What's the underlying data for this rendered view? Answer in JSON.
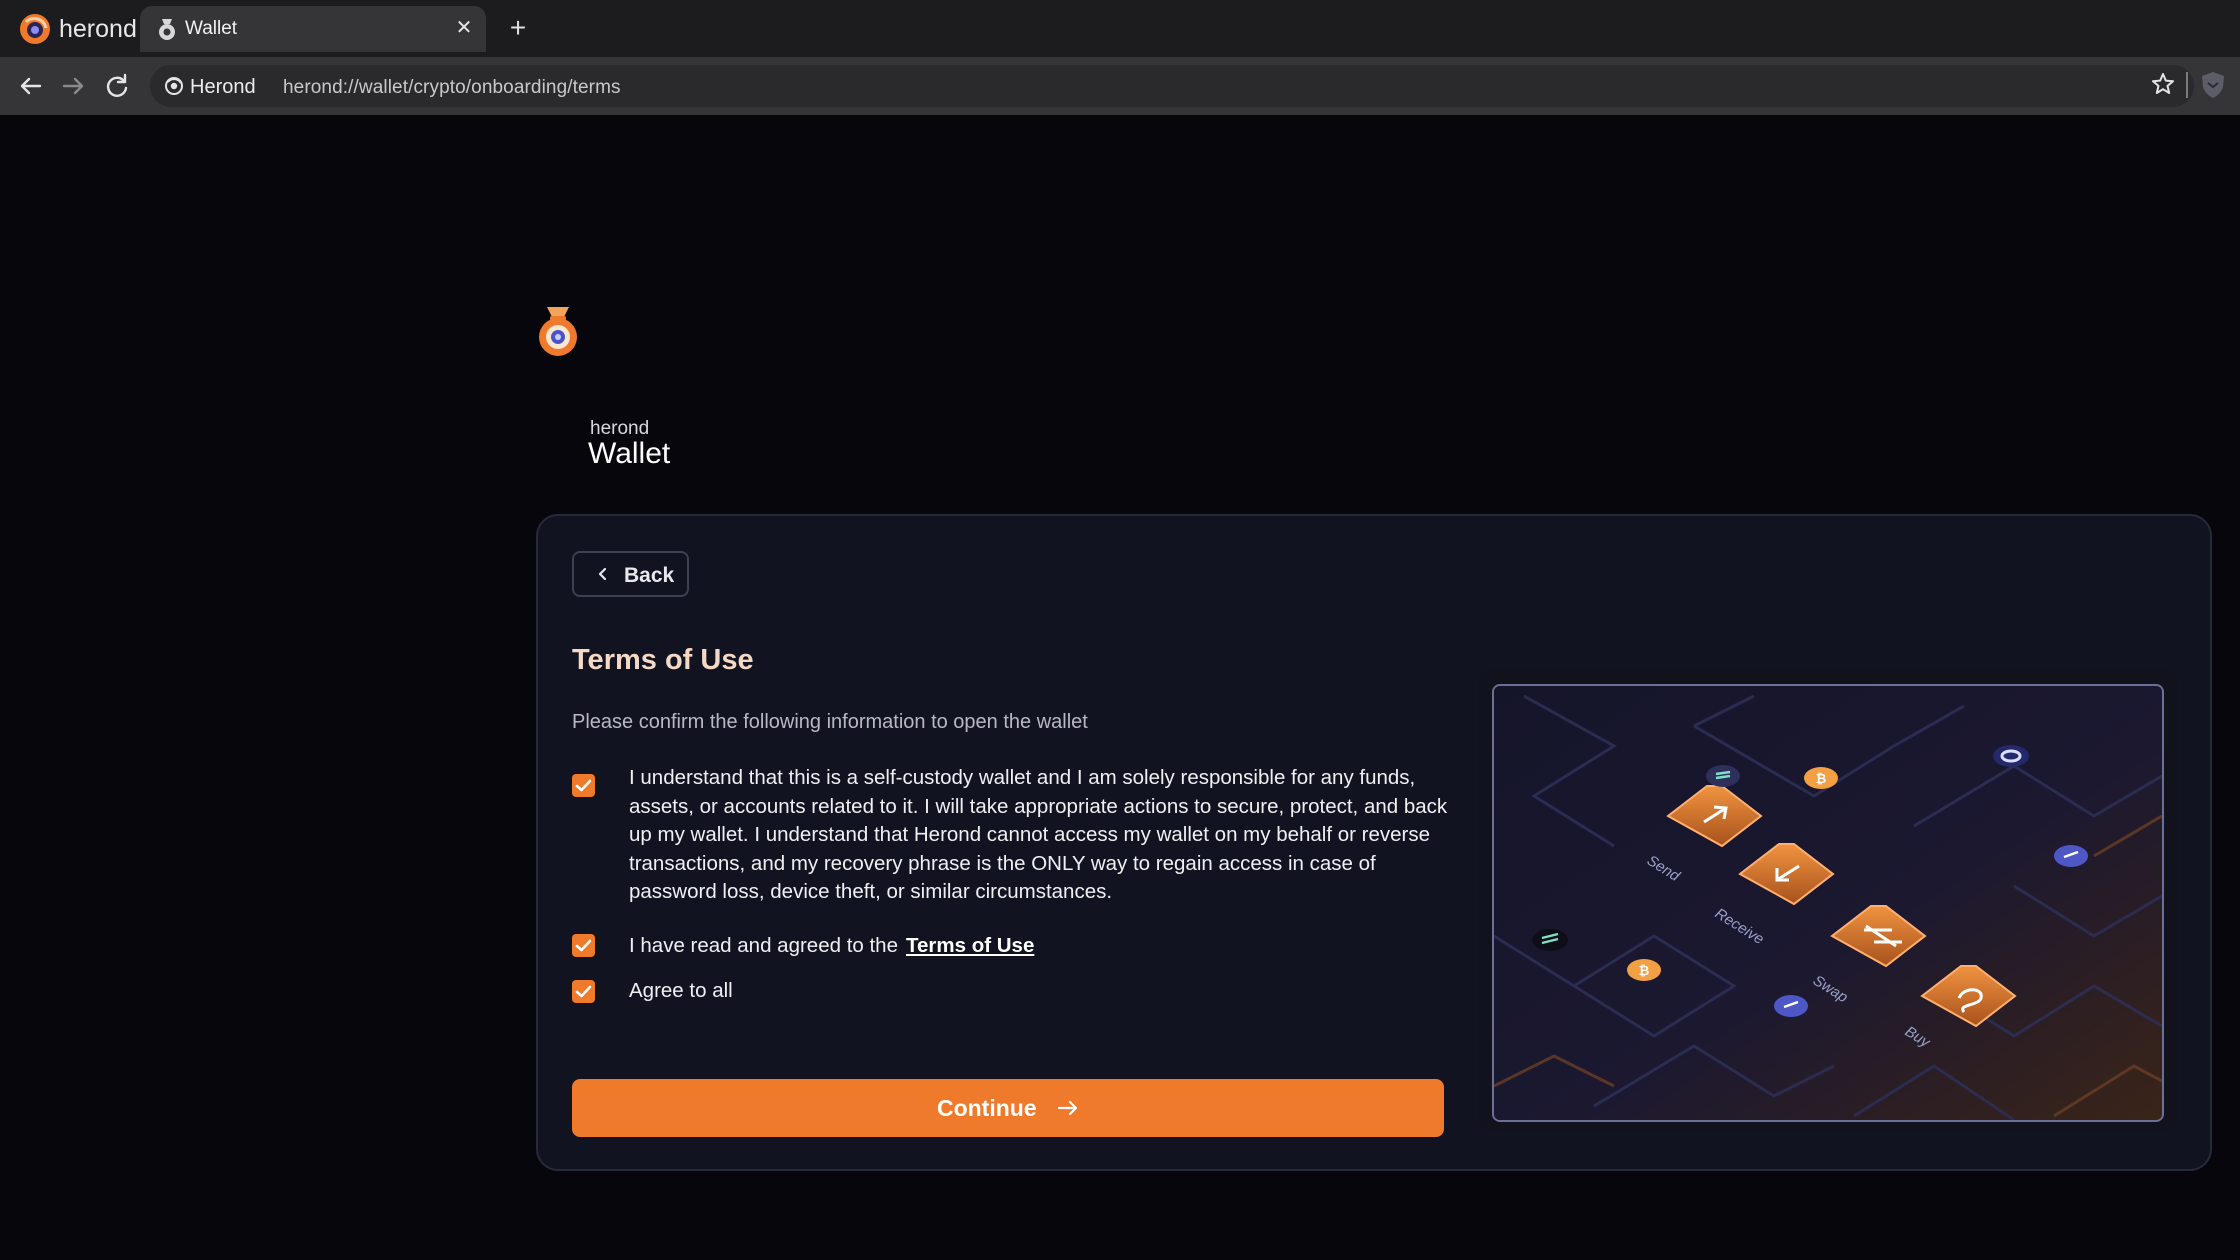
{
  "browser": {
    "brand": "herond",
    "tab_title": "Wallet",
    "site_chip": "Herond",
    "url": "herond://wallet/crypto/onboarding/terms"
  },
  "logo": {
    "small": "herond",
    "big": "Wallet"
  },
  "card": {
    "back_label": "Back",
    "title": "Terms of Use",
    "subtitle": "Please confirm the following information to open the wallet",
    "checkboxes": [
      {
        "label": "I understand that this is a self-custody wallet and I am solely responsible for any funds, assets, or accounts related to it. I will take appropriate actions to secure, protect, and back up my wallet. I understand that Herond cannot access my wallet on my behalf or reverse transactions, and my recovery phrase is the ONLY way to regain access in case of password loss, device theft, or similar circumstances.",
        "checked": true
      },
      {
        "label": "I have read and agreed to the",
        "link": "Terms of Use",
        "checked": true
      },
      {
        "label": "Agree to all",
        "checked": true
      }
    ],
    "continue_label": "Continue"
  },
  "illustration": {
    "labels": [
      "Send",
      "Receive",
      "Swap",
      "Buy"
    ]
  },
  "colors": {
    "accent": "#f07a2c",
    "background": "#06060c",
    "card": "#111320",
    "title": "#f5d9c4"
  }
}
